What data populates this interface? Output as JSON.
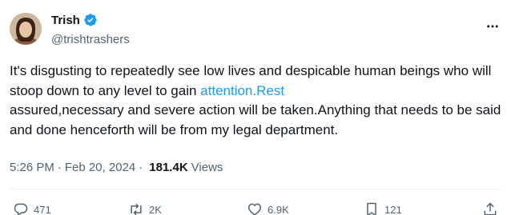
{
  "author": {
    "display_name": "Trish",
    "handle": "@trishtrashers",
    "verified": true
  },
  "tweet": {
    "text_before_link": "It's disgusting to repeatedly see low lives and despicable human beings who will stoop down to any level to gain ",
    "link_text": "attention.Rest",
    "text_after_link": "\nassured,necessary and severe action will be taken.Anything that needs to be said and done henceforth will be from my legal department."
  },
  "meta": {
    "time": "5:26 PM",
    "separator": "·",
    "date": "Feb 20, 2024",
    "views_count": "181.4K",
    "views_label": "Views"
  },
  "actions": {
    "replies": "471",
    "reposts": "2K",
    "likes": "6.9K",
    "bookmarks": "121"
  },
  "colors": {
    "accent": "#1d9bf0",
    "text": "#0f1419",
    "muted": "#536471"
  }
}
